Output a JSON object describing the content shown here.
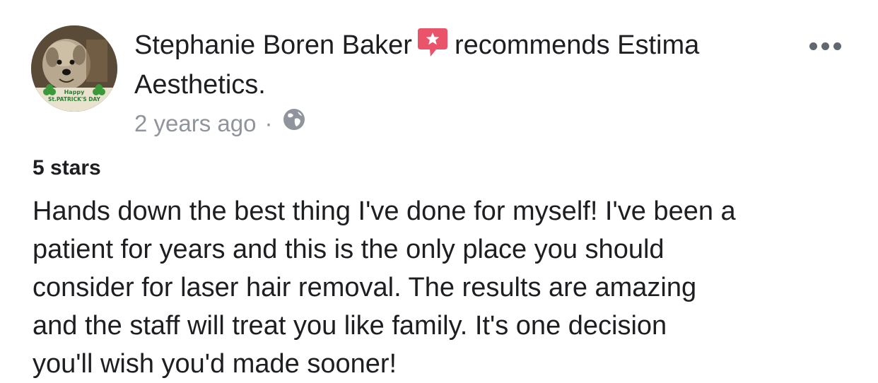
{
  "post": {
    "author_name": "Stephanie Boren Baker",
    "action_text": "recommends Estima",
    "page_name_line2": "Aesthetics.",
    "recommend_icon": "recommend-star-bubble-icon",
    "more_icon": "more-options-icon",
    "timestamp": "2 years ago",
    "separator": "·",
    "privacy_icon": "globe-icon",
    "avatar_caption": "Happy St. Patrick's Day",
    "rating_text": "5 stars",
    "review_lines": [
      "Hands down the best thing I've done for myself! I've been a",
      "patient for years and this is the only place you should",
      "consider for laser hair removal. The results are amazing",
      "and the staff will treat you like family. It's one decision",
      "you'll wish you'd made sooner!"
    ]
  },
  "colors": {
    "recommend_badge": "#e9546b",
    "meta_text": "#90949c",
    "primary_text": "#1c1e21",
    "shamrock": "#3a9a3a"
  }
}
